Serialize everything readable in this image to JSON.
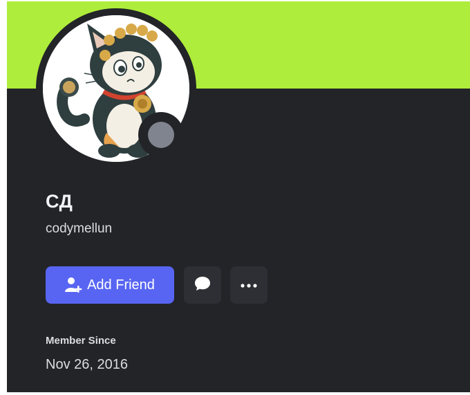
{
  "profile": {
    "display_name": "СД",
    "username": "codymellun",
    "avatar_icon": "cat-avatar-image",
    "status": "offline",
    "status_icon": "status-dot-icon"
  },
  "actions": {
    "add_friend_label": "Add Friend",
    "add_friend_icon": "add-user-icon",
    "message_icon": "chat-bubble-icon",
    "more_icon": "more-dots-icon"
  },
  "member_since": {
    "label": "Member Since",
    "value": "Nov 26, 2016"
  },
  "colors": {
    "banner": "#aeed3b",
    "card_background": "#232428",
    "accent_button": "#5865f2",
    "status_offline": "#80848e",
    "secondary_button": "#2e2f34"
  }
}
